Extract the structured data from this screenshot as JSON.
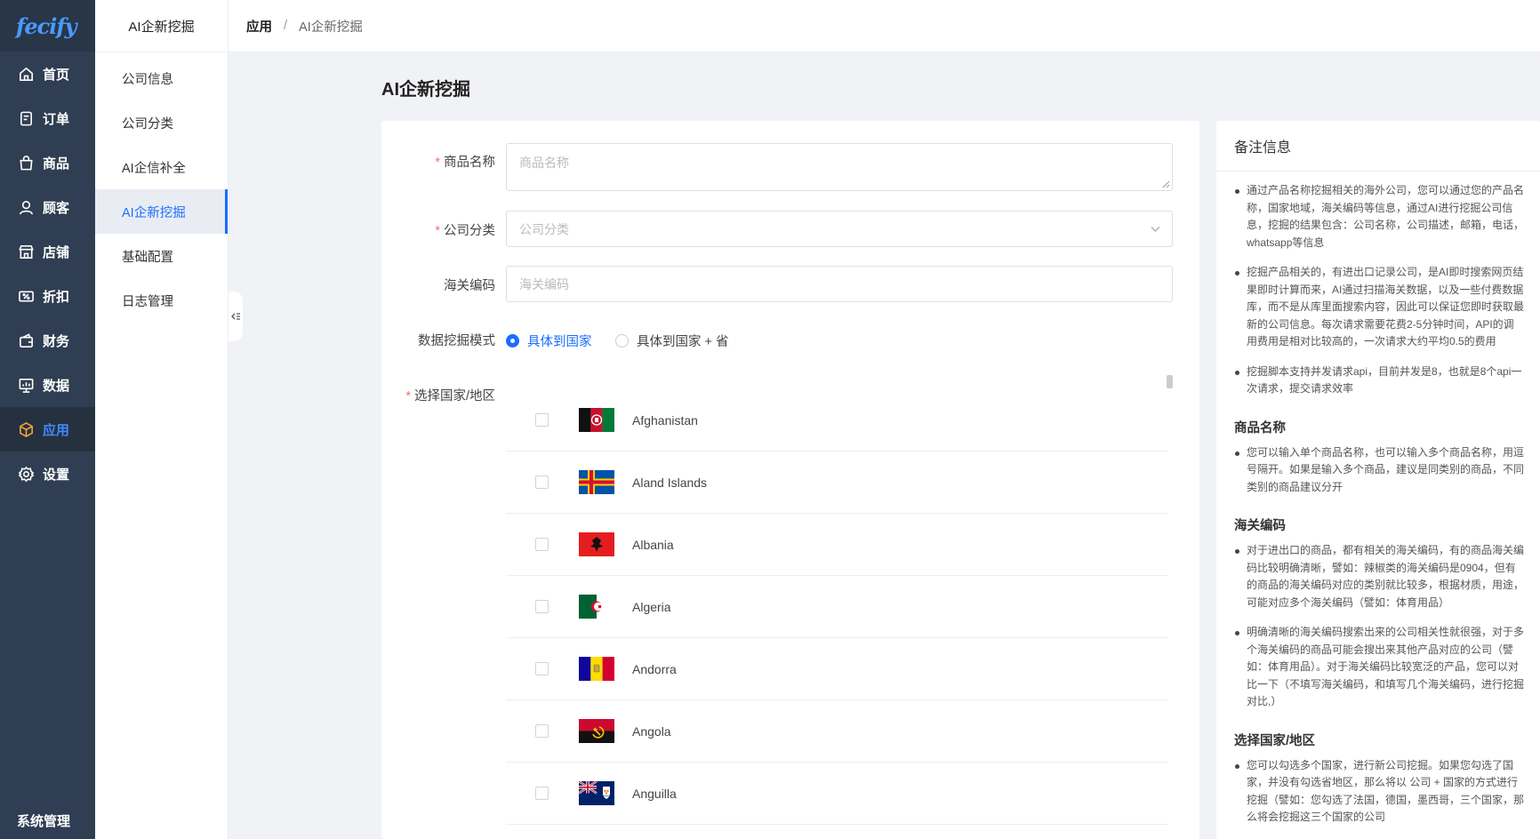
{
  "logo": "fecify",
  "nav": {
    "items": [
      {
        "label": "首页",
        "icon": "home-icon"
      },
      {
        "label": "订单",
        "icon": "order-icon"
      },
      {
        "label": "商品",
        "icon": "bag-icon"
      },
      {
        "label": "顾客",
        "icon": "user-icon"
      },
      {
        "label": "店铺",
        "icon": "store-icon"
      },
      {
        "label": "折扣",
        "icon": "discount-icon"
      },
      {
        "label": "财务",
        "icon": "wallet-icon"
      },
      {
        "label": "数据",
        "icon": "chart-icon"
      },
      {
        "label": "应用",
        "icon": "app-icon",
        "active": true
      },
      {
        "label": "设置",
        "icon": "gear-icon"
      }
    ],
    "system": "系统管理"
  },
  "subnav": {
    "title": "AI企新挖掘",
    "items": [
      "公司信息",
      "公司分类",
      "AI企信补全",
      "AI企新挖掘",
      "基础配置",
      "日志管理"
    ],
    "active_index": 3
  },
  "breadcrumb": {
    "root": "应用",
    "sep": "/",
    "current": "AI企新挖掘"
  },
  "page": {
    "title": "AI企新挖掘"
  },
  "form": {
    "product": {
      "label": "商品名称",
      "placeholder": "商品名称"
    },
    "category": {
      "label": "公司分类",
      "placeholder": "公司分类"
    },
    "hs": {
      "label": "海关编码",
      "placeholder": "海关编码"
    },
    "mode": {
      "label": "数据挖掘模式",
      "options": [
        "具体到国家",
        "具体到国家 + 省"
      ],
      "selected": 0
    },
    "country_label": "选择国家/地区",
    "countries": [
      "Afghanistan",
      "Aland Islands",
      "Albania",
      "Algeria",
      "Andorra",
      "Angola",
      "Anguilla"
    ]
  },
  "notes": {
    "title": "备注信息",
    "intro": [
      "通过产品名称挖掘相关的海外公司，您可以通过您的产品名称，国家地域，海关编码等信息，通过AI进行挖掘公司信息，挖掘的结果包含：公司名称，公司描述，邮箱，电话，whatsapp等信息",
      "挖掘产品相关的，有进出口记录公司，是AI即时搜索网页结果即时计算而来，AI通过扫描海关数据，以及一些付费数据库，而不是从库里面搜索内容，因此可以保证您即时获取最新的公司信息。每次请求需要花费2-5分钟时间，API的调用费用是相对比较高的，一次请求大约平均0.5的费用",
      "挖掘脚本支持并发请求api，目前并发是8，也就是8个api一次请求，提交请求效率"
    ],
    "product_title": "商品名称",
    "product_notes": [
      "您可以输入单个商品名称，也可以输入多个商品名称，用逗号隔开。如果是输入多个商品，建议是同类别的商品，不同类别的商品建议分开"
    ],
    "hs_title": "海关编码",
    "hs_notes": [
      "对于进出口的商品，都有相关的海关编码，有的商品海关编码比较明确清晰，譬如：辣椒类的海关编码是0904，但有的商品的海关编码对应的类别就比较多，根据材质，用途，可能对应多个海关编码（譬如：体育用品）",
      "明确清晰的海关编码搜索出来的公司相关性就很强，对于多个海关编码的商品可能会搜出来其他产品对应的公司（譬如：体育用品）。对于海关编码比较宽泛的产品，您可以对比一下（不填写海关编码，和填写几个海关编码，进行挖掘对比,）"
    ],
    "country_title": "选择国家/地区",
    "country_notes": [
      "您可以勾选多个国家，进行新公司挖掘。如果您勾选了国家，并没有勾选省地区，那么将以 公司 + 国家的方式进行挖掘（譬如：您勾选了法国，德国，墨西哥，三个国家，那么将会挖掘这三个国家的公司"
    ]
  }
}
